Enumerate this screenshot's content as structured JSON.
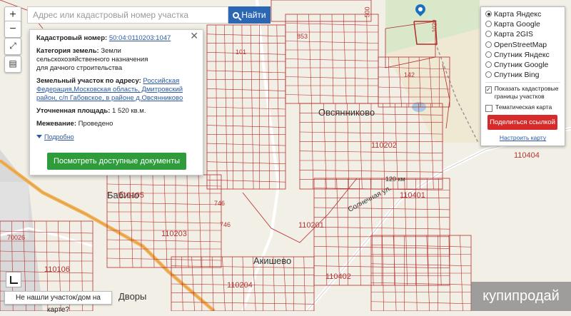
{
  "colors": {
    "parcel_line": "#b52b2b",
    "accent_blue": "#2c67b3",
    "green_button": "#2f9c3b",
    "red_button": "#d72b2b",
    "road_orange": "#f3b25a"
  },
  "zoom": {
    "in_label": "+",
    "out_label": "−"
  },
  "tools": {
    "fullscreen_icon": "expand-icon",
    "print_icon": "printer-icon"
  },
  "search": {
    "placeholder": "Адрес или кадастровый номер участка",
    "button_label": "Найти"
  },
  "info_panel": {
    "cadastral_label": "Кадастровый номер:",
    "cadastral_value": "50:04:0110203:1047",
    "category_label": "Категория земель:",
    "category_value": "Земли сельскохозяйственного назначения",
    "category_purpose": "для дачного строительства",
    "address_label": "Земельный участок по адресу:",
    "address_value": "Российская Федерация,Московская область, Дмитровский район, с/п Габовское, в районе д.Овсянниково",
    "area_label": "Уточненная площадь:",
    "area_value": "1 520 кв.м.",
    "survey_label": "Межевание:",
    "survey_value": "Проведено",
    "more_link": "Подробно",
    "docs_button": "Посмотреть доступные документы",
    "close_symbol": "✕"
  },
  "layers_panel": {
    "options": [
      {
        "label": "Карта Яндекс",
        "selected": true
      },
      {
        "label": "Карта Google",
        "selected": false
      },
      {
        "label": "Карта 2GIS",
        "selected": false
      },
      {
        "label": "OpenStreetMap",
        "selected": false
      },
      {
        "label": "Спутник Яндекс",
        "selected": false
      },
      {
        "label": "Спутник Google",
        "selected": false
      },
      {
        "label": "Спутник Bing",
        "selected": false
      }
    ],
    "show_borders_label": "Показать кадастровые границы участков",
    "show_borders_checked": true,
    "thematic_label": "Тематическая карта",
    "thematic_checked": false,
    "share_button": "Поделиться ссылкой",
    "setup_link": "Настроить карту"
  },
  "bottom": {
    "not_found_label": "Не нашли участок/дом на карте?"
  },
  "watermark": "купипродай",
  "map_labels": {
    "village_1": "Овсянниково",
    "village_2": "Акишево",
    "village_3": "Бабино",
    "village_4": "Дворы",
    "q1": "110404",
    "q2": "110202",
    "q3": "110203",
    "q4": "110204",
    "q5": "110106",
    "q6": "110105",
    "q7": "110401",
    "q8": "110402",
    "q9": "110201",
    "p1": "746",
    "p2": "746",
    "p3": "142",
    "p4": "500",
    "p5": "853",
    "p6": "101",
    "p7": "70026",
    "p8": "1029",
    "km": "120 км",
    "street": "Солнечная ул."
  }
}
